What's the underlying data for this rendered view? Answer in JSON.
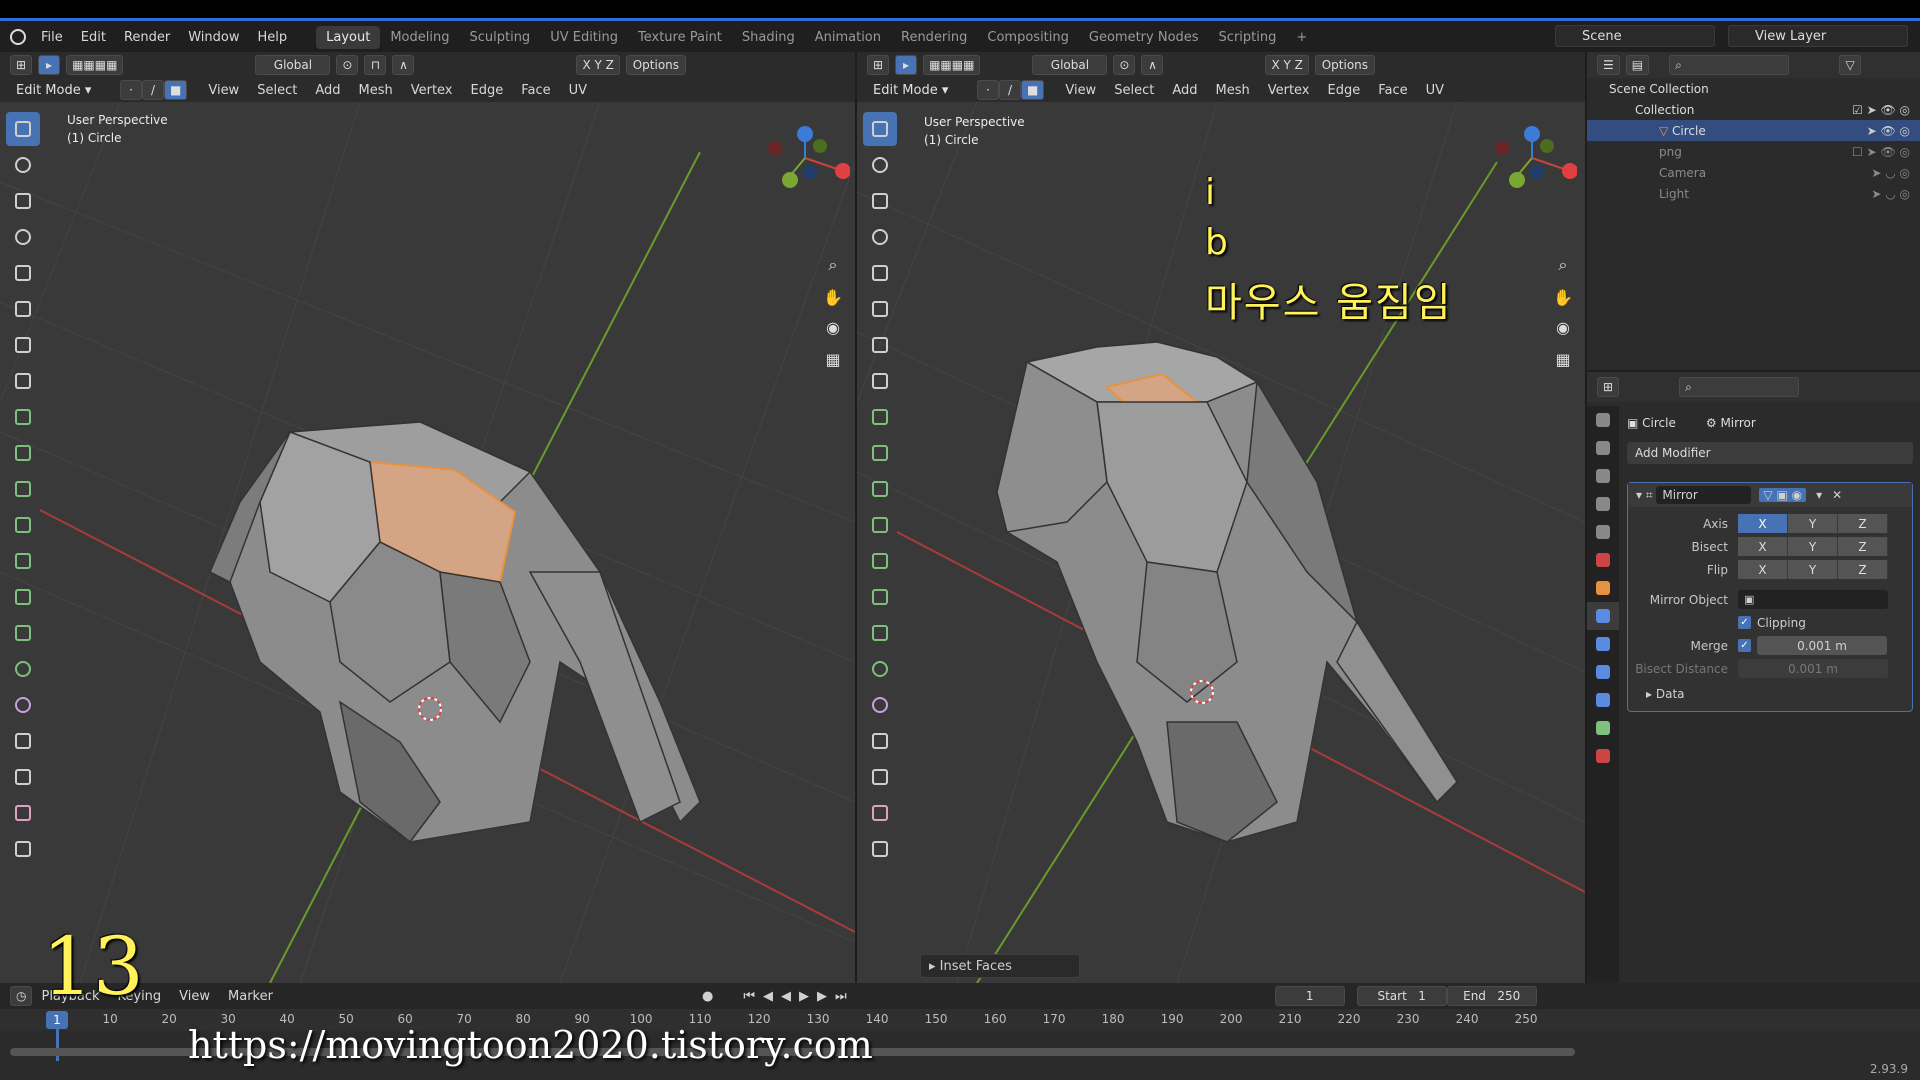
{
  "menu": [
    "File",
    "Edit",
    "Render",
    "Window",
    "Help"
  ],
  "workspaces": [
    "Layout",
    "Modeling",
    "Sculpting",
    "UV Editing",
    "Texture Paint",
    "Shading",
    "Animation",
    "Rendering",
    "Compositing",
    "Geometry Nodes",
    "Scripting"
  ],
  "active_workspace": "Layout",
  "scene_name": "Scene",
  "view_layer": "View Layer",
  "viewport_left": {
    "transform_orientation": "Global",
    "options_label": "Options",
    "mode": "Edit Mode",
    "menus": [
      "View",
      "Select",
      "Add",
      "Mesh",
      "Vertex",
      "Edge",
      "Face",
      "UV"
    ],
    "perspective": "User Perspective",
    "object": "(1) Circle"
  },
  "viewport_right": {
    "transform_orientation": "Global",
    "options_label": "Options",
    "mode": "Edit Mode",
    "menus": [
      "View",
      "Select",
      "Add",
      "Mesh",
      "Vertex",
      "Edge",
      "Face",
      "UV"
    ],
    "perspective": "User Perspective",
    "object": "(1) Circle",
    "last_operator": "Inset Faces"
  },
  "annotations": {
    "line1": "i",
    "line2": "b",
    "line3": "마우스 움짐임",
    "step": "13",
    "url": "https://movingtoon2020.tistory.com"
  },
  "outliner": {
    "root": "Scene Collection",
    "items": [
      {
        "label": "Collection"
      },
      {
        "label": "Circle"
      },
      {
        "label": "png"
      },
      {
        "label": "Camera"
      },
      {
        "label": "Light"
      }
    ]
  },
  "properties": {
    "object": "Circle",
    "modifier_tab": "Mirror",
    "add_modifier": "Add Modifier",
    "modifier_name": "Mirror",
    "axis_label": "Axis",
    "bisect_label": "Bisect",
    "flip_label": "Flip",
    "axes": [
      "X",
      "Y",
      "Z"
    ],
    "mirror_object_label": "Mirror Object",
    "clipping_label": "Clipping",
    "merge_label": "Merge",
    "merge_value": "0.001 m",
    "bisect_distance_label": "Bisect Distance",
    "bisect_distance_value": "0.001 m",
    "data_label": "Data"
  },
  "timeline": {
    "menus": [
      "Playback",
      "Keying",
      "View",
      "Marker"
    ],
    "current_frame": "1",
    "start_label": "Start",
    "start": "1",
    "end_label": "End",
    "end": "250",
    "ticks": [
      "1",
      "10",
      "20",
      "30",
      "40",
      "50",
      "60",
      "70",
      "80",
      "90",
      "100",
      "110",
      "120",
      "130",
      "140",
      "150",
      "160",
      "170",
      "180",
      "190",
      "200",
      "210",
      "220",
      "230",
      "240",
      "250"
    ]
  },
  "version": "2.93.9",
  "colors": {
    "accent": "#4772b3",
    "selected_face": "#d4a585",
    "annotation": "#fff25a",
    "x_axis": "#c84242",
    "y_axis": "#7aa632"
  }
}
